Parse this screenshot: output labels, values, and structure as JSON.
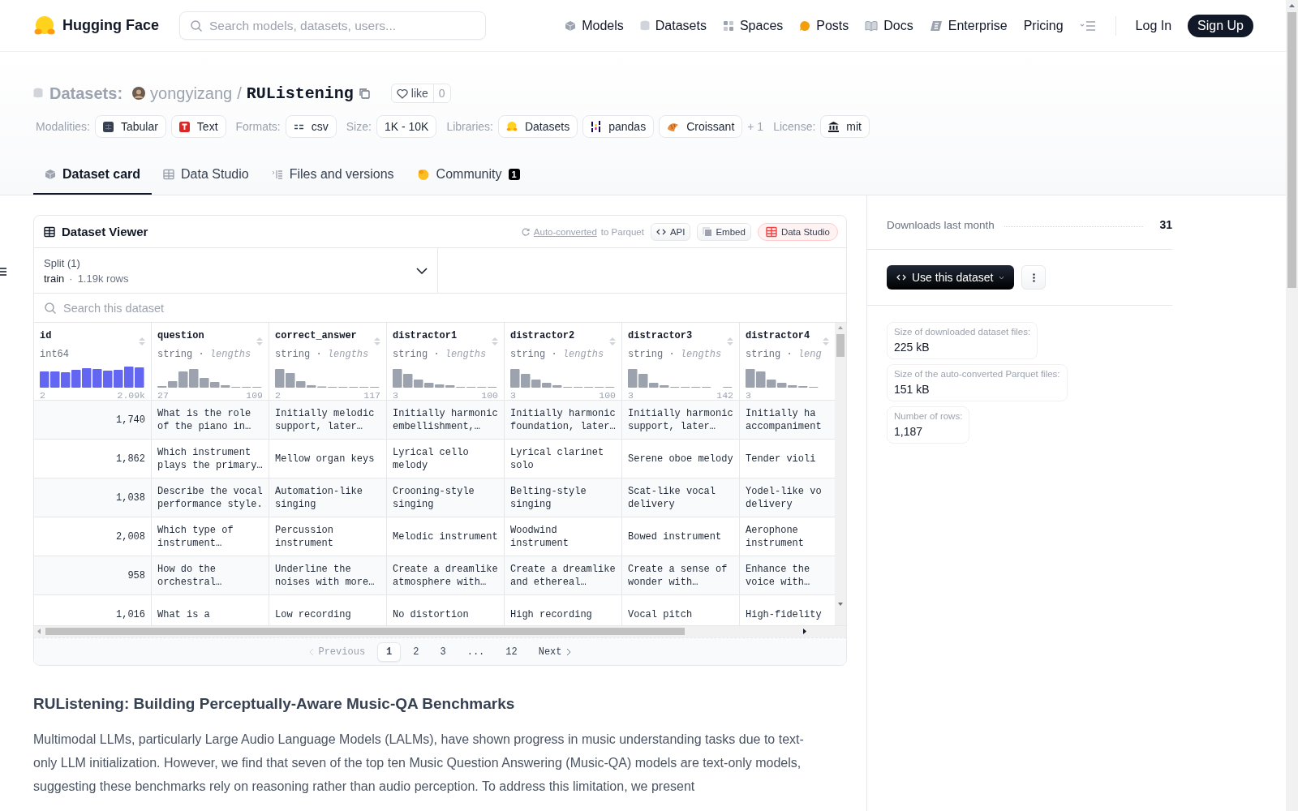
{
  "navbar": {
    "brand": "Hugging Face",
    "search": {
      "placeholder": "Search models, datasets, users..."
    },
    "links": [
      "Models",
      "Datasets",
      "Spaces",
      "Posts",
      "Docs",
      "Enterprise",
      "Pricing"
    ],
    "login": "Log In",
    "signup": "Sign Up"
  },
  "repo": {
    "type": "Datasets:",
    "owner": "yongyizang",
    "separator": "/",
    "name": "RUListening",
    "like": {
      "label": "like",
      "count": "0"
    },
    "tag_groups": [
      {
        "label": "Modalities:",
        "tags": [
          "Tabular",
          "Text"
        ]
      },
      {
        "label": "Formats:",
        "tags": [
          "csv"
        ]
      },
      {
        "label": "Size:",
        "tags": [
          "1K - 10K"
        ]
      },
      {
        "label": "Libraries:",
        "tags": [
          "Datasets",
          "pandas",
          "Croissant"
        ],
        "more": "+ 1"
      },
      {
        "label": "License:",
        "tags": [
          "mit"
        ]
      }
    ],
    "tabs": [
      {
        "label": "Dataset card",
        "selected": true
      },
      {
        "label": "Data Studio",
        "selected": false
      },
      {
        "label": "Files and versions",
        "selected": false
      },
      {
        "label": "Community",
        "selected": false,
        "badge": "1"
      }
    ]
  },
  "viewer": {
    "title": "Dataset Viewer",
    "auto_converted": "Auto-converted",
    "to_parquet": "to Parquet",
    "buttons": [
      "API",
      "Embed",
      "Data Studio"
    ],
    "split": {
      "label": "Split (1)",
      "name": "train",
      "separator": "·",
      "rows": "1.19k rows"
    },
    "search": {
      "placeholder": "Search this dataset"
    },
    "columns": [
      {
        "name": "id",
        "dtype": "int64",
        "kind": "numeric",
        "min": "2",
        "max": "2.09k"
      },
      {
        "name": "question",
        "dtype": "string",
        "separator": "·",
        "note": "lengths",
        "kind": "text",
        "min": "27",
        "max": "109"
      },
      {
        "name": "correct_answer",
        "dtype": "string",
        "separator": "·",
        "note": "lengths",
        "kind": "text",
        "min": "2",
        "max": "117"
      },
      {
        "name": "distractor1",
        "dtype": "string",
        "separator": "·",
        "note": "lengths",
        "kind": "text",
        "min": "3",
        "max": "100"
      },
      {
        "name": "distractor2",
        "dtype": "string",
        "separator": "·",
        "note": "lengths",
        "kind": "text",
        "min": "3",
        "max": "100"
      },
      {
        "name": "distractor3",
        "dtype": "string",
        "separator": "·",
        "note": "lengths",
        "kind": "text",
        "min": "3",
        "max": "142"
      },
      {
        "name": "distractor4",
        "dtype": "string",
        "separator": "·",
        "note": "leng",
        "kind": "text",
        "min": "3"
      }
    ],
    "rows": [
      [
        "1,740",
        "What is the role\nof the piano in…",
        "Initially melodic\nsupport, later…",
        "Initially harmonic\nembellishment,…",
        "Initially harmonic\nfoundation, later…",
        "Initially harmonic\nsupport, later…",
        "Initially ha\naccompaniment"
      ],
      [
        "1,862",
        "Which instrument\nplays the primary…",
        "Mellow organ keys",
        "Lyrical cello\nmelody",
        "Lyrical clarinet\nsolo",
        "Serene oboe melody",
        "Tender violi"
      ],
      [
        "1,038",
        "Describe the vocal\nperformance style.",
        "Automation-like\nsinging",
        "Crooning-style\nsinging",
        "Belting-style\nsinging",
        "Scat-like vocal\ndelivery",
        "Yodel-like vo\ndelivery"
      ],
      [
        "2,008",
        "Which type of\ninstrument…",
        "Percussion\ninstrument",
        "Melodic instrument",
        "Woodwind\ninstrument",
        "Bowed instrument",
        "Aerophone\ninstrument"
      ],
      [
        "958",
        "How do the\norchestral…",
        "Underline the\nnoises with more…",
        "Create a dreamlike\natmosphere with…",
        "Create a dreamlike\nand ethereal…",
        "Create a sense of\nwonder with…",
        "Enhance the\nvoice with…"
      ],
      [
        "1,016",
        "What is a",
        "Low recording",
        "No distortion",
        "High recording",
        "Vocal pitch",
        "High-fidelity"
      ]
    ],
    "pagination": {
      "previous": {
        "label": "Previous",
        "disabled": true
      },
      "next": {
        "label": "Next",
        "disabled": false
      },
      "pages": [
        {
          "label": "1",
          "selected": true
        },
        {
          "label": "2",
          "selected": false
        },
        {
          "label": "3",
          "selected": false
        },
        {
          "label": "...",
          "selected": false
        },
        {
          "label": "12",
          "selected": false
        }
      ]
    }
  },
  "card": {
    "heading": "RUListening: Building Perceptually-Aware Music-QA Benchmarks",
    "paragraph": "Multimodal LLMs, particularly Large Audio Language Models (LALMs), have shown progress in music understanding tasks due to text-only LLM initialization. However, we find that seven of the top ten Music Question Answering (Music-QA) models are text-only models, suggesting these benchmarks rely on reasoning rather than audio perception. To address this limitation, we present"
  },
  "sidebar": {
    "downloads": {
      "label": "Downloads last month",
      "value": "31"
    },
    "use_button": "Use this dataset",
    "stats": [
      {
        "label": "Size of downloaded dataset files:",
        "value": "225 kB"
      },
      {
        "label": "Size of the auto-converted Parquet files:",
        "value": "151 kB"
      },
      {
        "label": "Number of rows:",
        "value": "1,187"
      }
    ]
  }
}
